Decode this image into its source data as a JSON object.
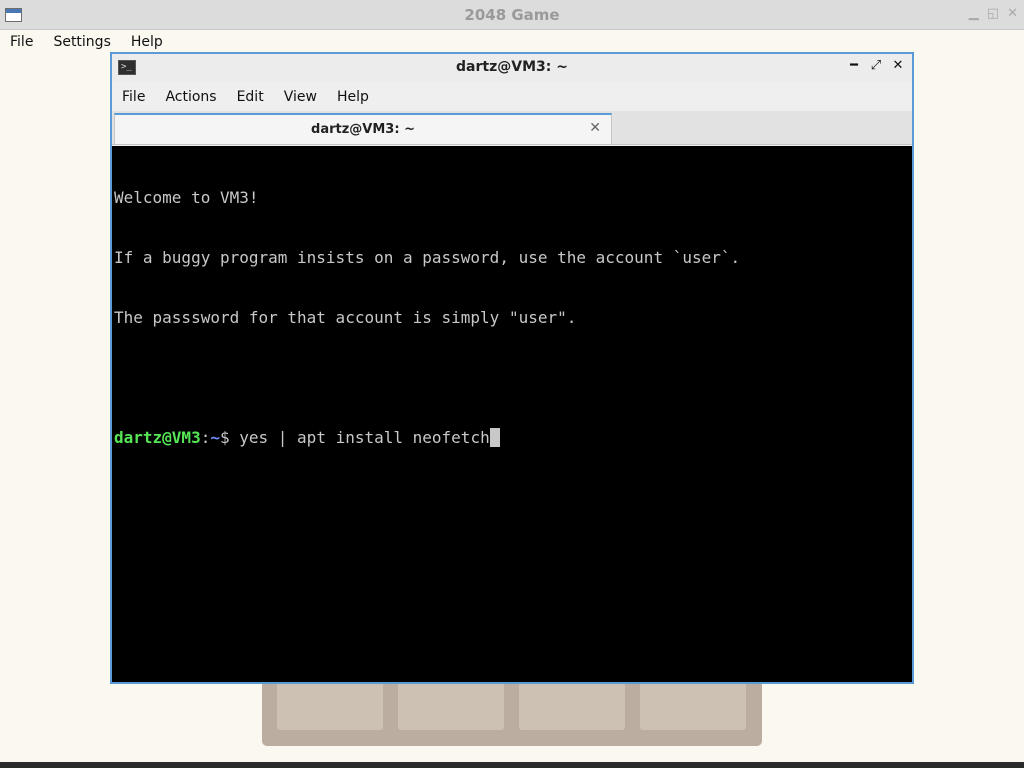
{
  "background_app": {
    "title": "2048 Game",
    "menu": [
      "File",
      "Settings",
      "Help"
    ]
  },
  "terminal": {
    "title": "dartz@VM3: ~",
    "menu": [
      "File",
      "Actions",
      "Edit",
      "View",
      "Help"
    ],
    "tab": {
      "label": "dartz@VM3: ~"
    },
    "lines": [
      "Welcome to VM3!",
      "If a buggy program insists on a password, use the account `user`.",
      "The passsword for that account is simply \"user\"."
    ],
    "prompt": {
      "user_host": "dartz@VM3",
      "colon": ":",
      "dir": "~",
      "symbol": "$ ",
      "command": "yes | apt install neofetch"
    }
  },
  "icons": {
    "app": "window-icon",
    "terminal": "terminal-icon",
    "minimize": "minimize-icon",
    "maximize": "maximize-icon",
    "close": "close-icon"
  },
  "colors": {
    "accent": "#5b9bd5",
    "prompt_user": "#55e655",
    "prompt_dir": "#6b8bff",
    "terminal_bg": "#000000",
    "game_board": "#bbada0"
  }
}
